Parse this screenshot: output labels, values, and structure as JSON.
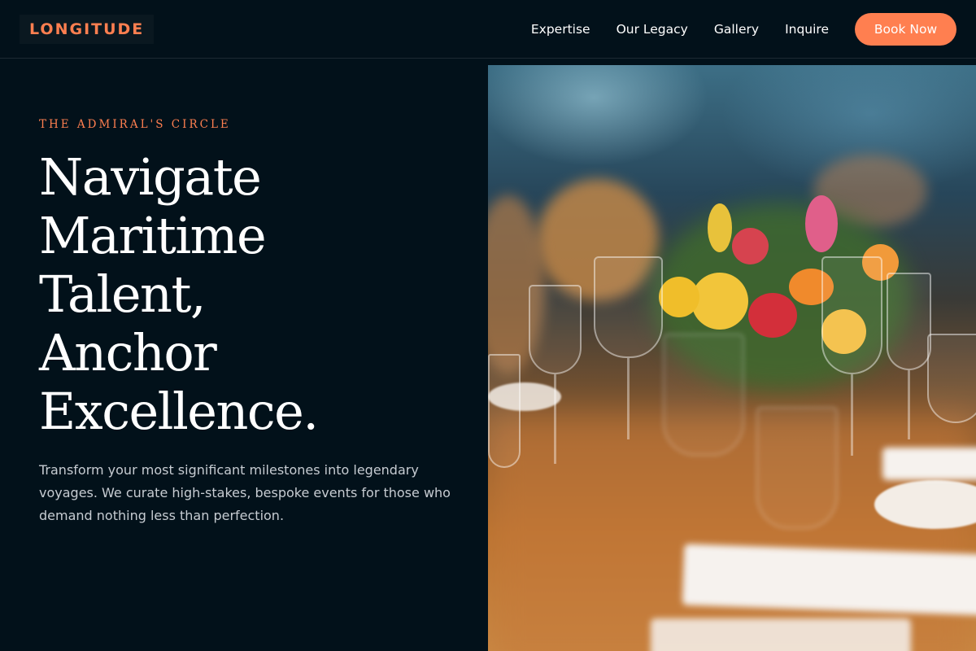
{
  "header": {
    "logo": "LONGITUDE",
    "nav": [
      {
        "label": "Expertise"
      },
      {
        "label": "Our Legacy"
      },
      {
        "label": "Gallery"
      },
      {
        "label": "Inquire"
      }
    ],
    "cta_label": "Book Now"
  },
  "hero": {
    "eyebrow": "THE ADMIRAL'S CIRCLE",
    "headline_lines": [
      "Navigate",
      "Maritime",
      "Talent,",
      "Anchor",
      "Excellence."
    ],
    "description": "Transform your most significant milestones into legendary voyages. We curate high-stakes, bespoke events for those who demand nothing less than perfection."
  },
  "colors": {
    "background": "#02111a",
    "accent": "#ff7f50",
    "body_text": "#c7ccd2"
  }
}
